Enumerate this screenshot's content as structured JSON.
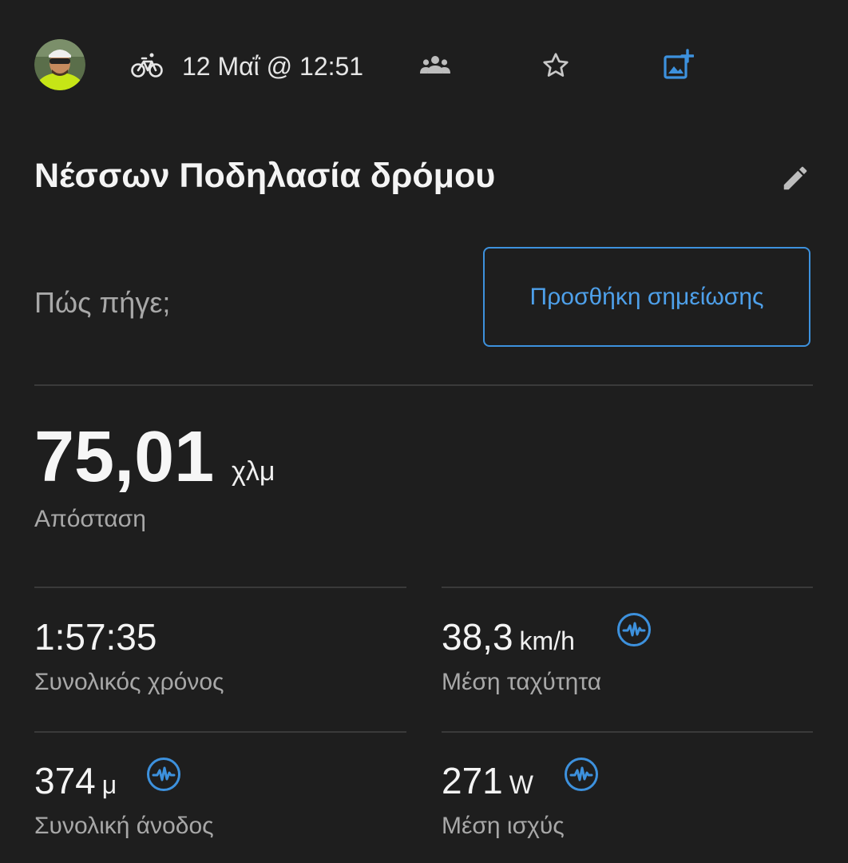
{
  "header": {
    "date": "12 Μαΐ @ 12:51",
    "avatar_icon": "user-avatar",
    "activity_icon": "bicycle-icon",
    "group_icon": "people-icon",
    "favorite_icon": "star-icon",
    "add_photo_icon": "add-photo-icon"
  },
  "activity": {
    "title": "Νέσσων Ποδηλασία δρόμου",
    "edit_icon": "pencil-icon"
  },
  "note": {
    "prompt": "Πώς πήγε;",
    "button_label": "Προσθήκη σημείωσης"
  },
  "distance": {
    "value": "75,01",
    "unit": "χλμ",
    "label": "Απόσταση"
  },
  "stats": [
    {
      "value": "1:57:35",
      "unit": "",
      "label": "Συνολικός χρόνος",
      "has_pulse": false
    },
    {
      "value": "38,3",
      "unit": "km/h",
      "label": "Μέση ταχύτητα",
      "has_pulse": true
    },
    {
      "value": "374",
      "unit": "μ",
      "label": "Συνολική άνοδος",
      "has_pulse": true
    },
    {
      "value": "271",
      "unit": "W",
      "label": "Μέση ισχύς",
      "has_pulse": true
    }
  ],
  "colors": {
    "background": "#1e1e1e",
    "accent": "#3d91dd",
    "muted_text": "#a8a8a8",
    "divider": "#3a3a3a"
  }
}
